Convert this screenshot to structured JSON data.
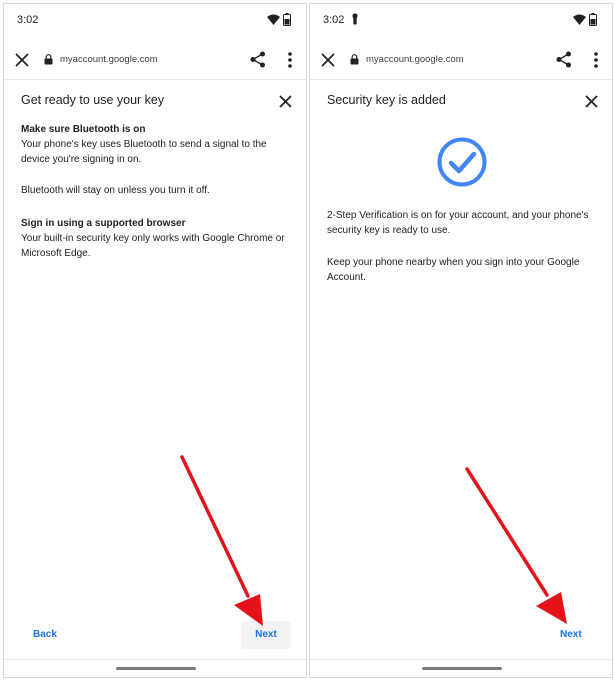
{
  "left": {
    "status": {
      "time": "3:02"
    },
    "url": "myaccount.google.com",
    "title": "Get ready to use your key",
    "sections": [
      {
        "heading": "Make sure Bluetooth is on",
        "body": "Your phone's key uses Bluetooth to send a signal to the device you're signing in on."
      },
      {
        "heading": "",
        "body": "Bluetooth will stay on unless you turn it off."
      },
      {
        "heading": "Sign in using a supported browser",
        "body": "Your built-in security key only works with Google Chrome or Microsoft Edge."
      }
    ],
    "back_label": "Back",
    "next_label": "Next"
  },
  "right": {
    "status": {
      "time": "3:02"
    },
    "url": "myaccount.google.com",
    "title": "Security key is added",
    "paragraphs": [
      "2-Step Verification is on for your account, and your phone's security key is ready to use.",
      "Keep your phone nearby when you sign into your Google Account."
    ],
    "next_label": "Next"
  },
  "colors": {
    "accent": "#1a73e8",
    "check": "#4285f4",
    "arrow": "#e4121b"
  }
}
